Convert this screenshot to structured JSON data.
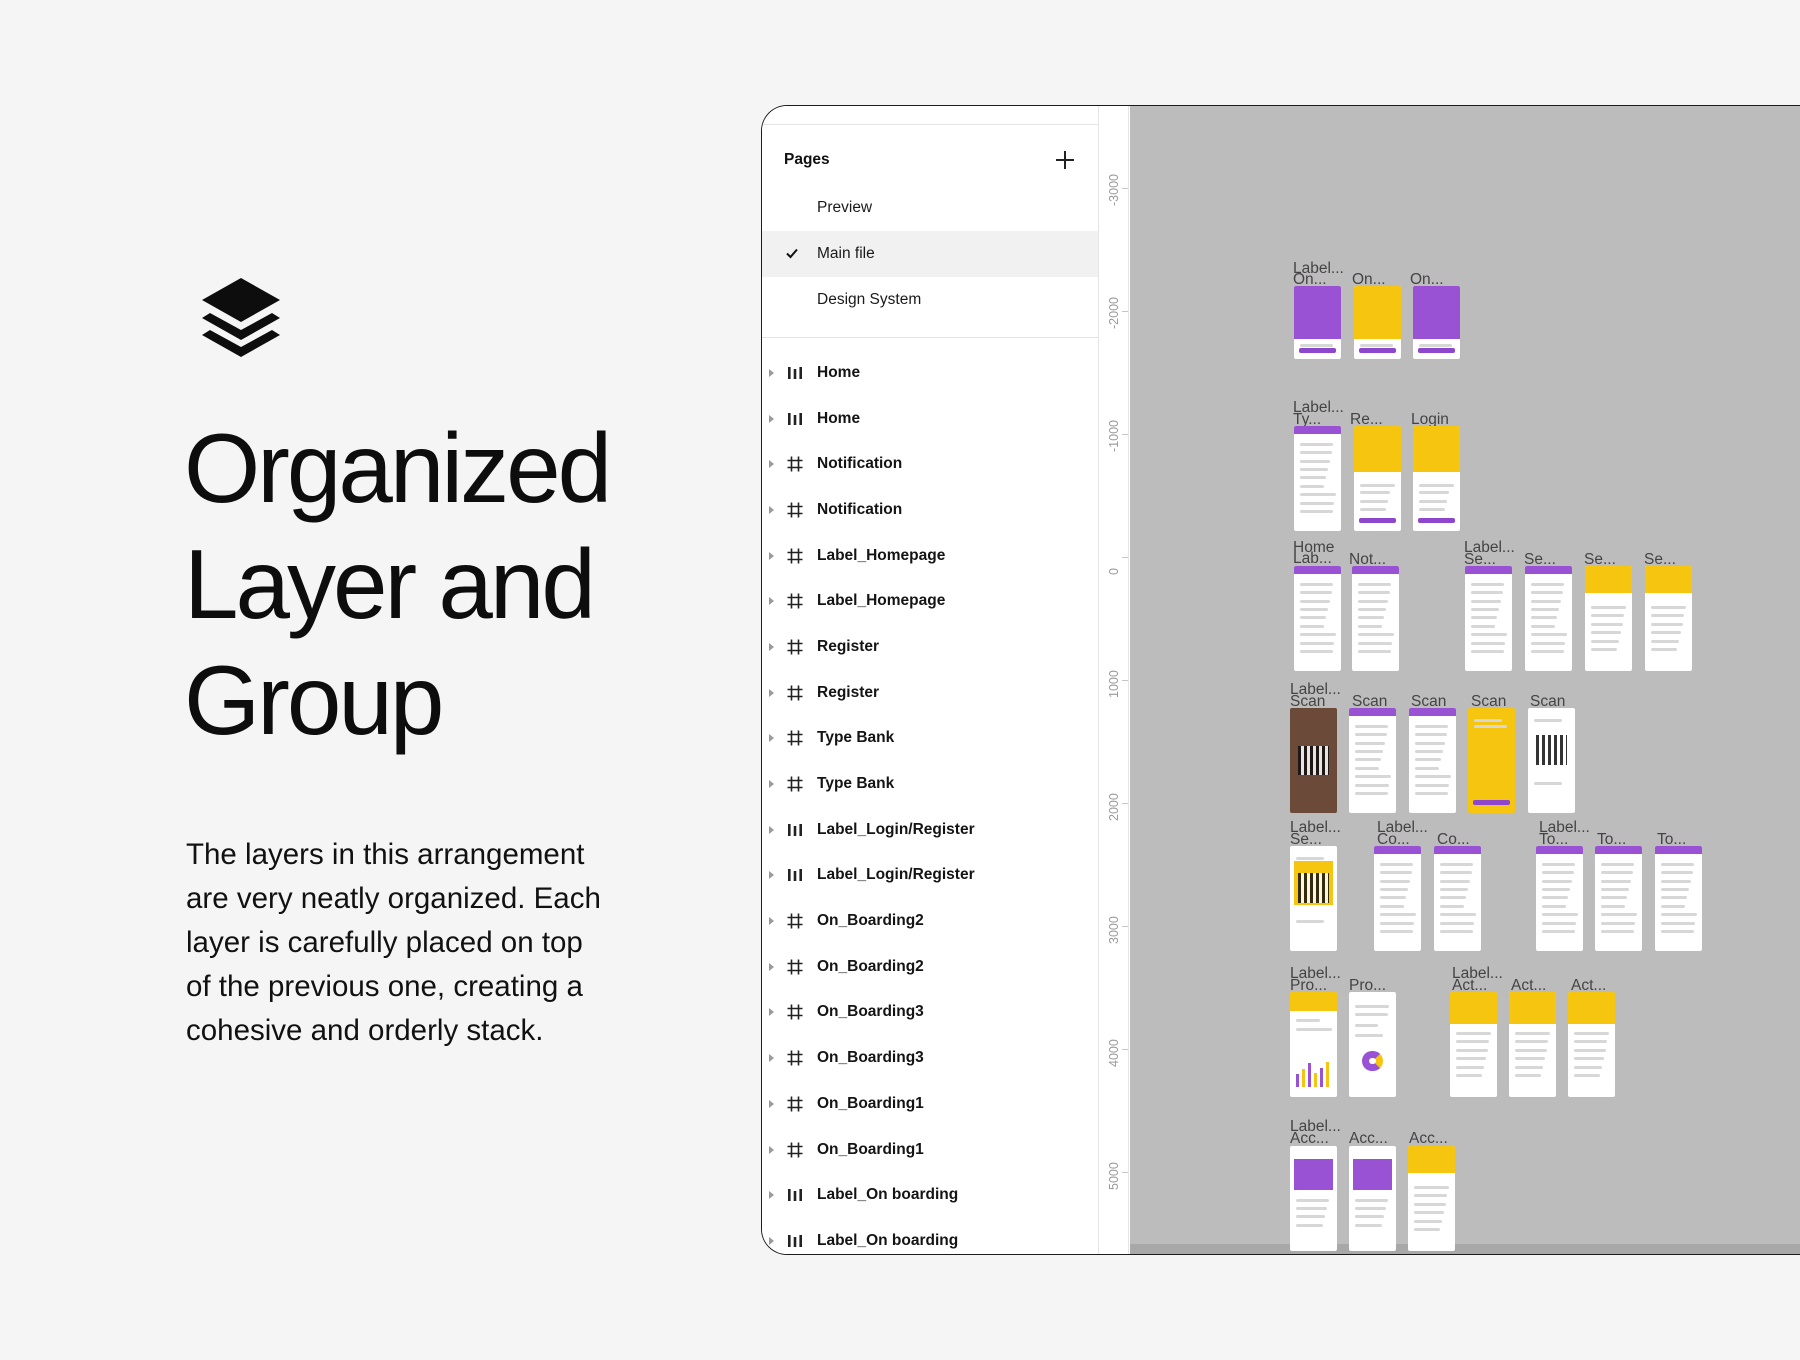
{
  "promo": {
    "headline": [
      "Organized",
      "Layer and",
      "Group"
    ],
    "description": "The layers in this arrangement are very neatly organized. Each layer is carefully placed on top of the previous one, creating a cohesive and orderly stack."
  },
  "colors": {
    "accent_purple": "#9a52d4",
    "accent_yellow": "#f6c510",
    "canvas": "#bcbcbc"
  },
  "pages_panel": {
    "title": "Pages",
    "pages": [
      {
        "label": "Preview",
        "selected": false
      },
      {
        "label": "Main file",
        "selected": true
      },
      {
        "label": "Design System",
        "selected": false
      }
    ]
  },
  "layers": [
    {
      "label": "Home",
      "icon": "section-icon"
    },
    {
      "label": "Home",
      "icon": "section-icon"
    },
    {
      "label": "Notification",
      "icon": "frame-icon"
    },
    {
      "label": "Notification",
      "icon": "frame-icon"
    },
    {
      "label": "Label_Homepage",
      "icon": "frame-icon"
    },
    {
      "label": "Label_Homepage",
      "icon": "frame-icon"
    },
    {
      "label": "Register",
      "icon": "frame-icon"
    },
    {
      "label": "Register",
      "icon": "frame-icon"
    },
    {
      "label": "Type Bank",
      "icon": "frame-icon"
    },
    {
      "label": "Type Bank",
      "icon": "frame-icon"
    },
    {
      "label": "Label_Login/Register",
      "icon": "section-icon"
    },
    {
      "label": "Label_Login/Register",
      "icon": "section-icon"
    },
    {
      "label": "On_Boarding2",
      "icon": "frame-icon"
    },
    {
      "label": "On_Boarding2",
      "icon": "frame-icon"
    },
    {
      "label": "On_Boarding3",
      "icon": "frame-icon"
    },
    {
      "label": "On_Boarding3",
      "icon": "frame-icon"
    },
    {
      "label": "On_Boarding1",
      "icon": "frame-icon"
    },
    {
      "label": "On_Boarding1",
      "icon": "frame-icon"
    },
    {
      "label": "Label_On boarding",
      "icon": "section-icon"
    },
    {
      "label": "Label_On boarding",
      "icon": "section-icon"
    }
  ],
  "ruler": [
    "-3000",
    "-2000",
    "-1000",
    "0",
    "1000",
    "2000",
    "3000",
    "4000",
    "5000"
  ],
  "canvas_labels": [
    "Label...",
    "On...",
    "On...",
    "On...",
    "Label...",
    "Ty...",
    "Re...",
    "Login",
    "Home",
    "Lab...",
    "Not...",
    "Label...",
    "Se...",
    "Se...",
    "Se...",
    "Se...",
    "Label...",
    "Scan",
    "Scan",
    "Scan",
    "Scan",
    "Scan",
    "Label...",
    "Se...",
    "Label...",
    "Co...",
    "Co...",
    "Label...",
    "To...",
    "To...",
    "To...",
    "Label...",
    "Pro...",
    "Pro...",
    "Label...",
    "Act...",
    "Act...",
    "Act...",
    "Label...",
    "Acc...",
    "Acc...",
    "Acc..."
  ],
  "canvas_frames": [
    {
      "kind": "onboard",
      "color": "purple"
    },
    {
      "kind": "onboard",
      "color": "yellow"
    },
    {
      "kind": "onboard",
      "color": "purple"
    },
    {
      "kind": "form",
      "color": "white"
    },
    {
      "kind": "onboard-small",
      "color": "yellow"
    },
    {
      "kind": "onboard-small",
      "color": "yellow"
    },
    {
      "kind": "home",
      "color": "white"
    },
    {
      "kind": "list",
      "color": "white"
    },
    {
      "kind": "list",
      "color": "white"
    },
    {
      "kind": "form",
      "color": "white"
    },
    {
      "kind": "band",
      "color": "white"
    },
    {
      "kind": "band",
      "color": "white"
    },
    {
      "kind": "photo",
      "color": "white"
    },
    {
      "kind": "form",
      "color": "white"
    },
    {
      "kind": "keypad",
      "color": "white"
    },
    {
      "kind": "success",
      "color": "yellow"
    },
    {
      "kind": "qr",
      "color": "white"
    },
    {
      "kind": "qr-yellow",
      "color": "white"
    },
    {
      "kind": "chart",
      "color": "white"
    },
    {
      "kind": "list",
      "color": "white"
    },
    {
      "kind": "list",
      "color": "white"
    },
    {
      "kind": "list",
      "color": "white"
    },
    {
      "kind": "form",
      "color": "white"
    },
    {
      "kind": "bars",
      "color": "white"
    },
    {
      "kind": "ring",
      "color": "white"
    },
    {
      "kind": "mountain",
      "color": "white"
    },
    {
      "kind": "mountain",
      "color": "white"
    },
    {
      "kind": "mountain",
      "color": "white"
    },
    {
      "kind": "card",
      "color": "white"
    },
    {
      "kind": "card",
      "color": "white"
    },
    {
      "kind": "card-yellow",
      "color": "white"
    }
  ]
}
